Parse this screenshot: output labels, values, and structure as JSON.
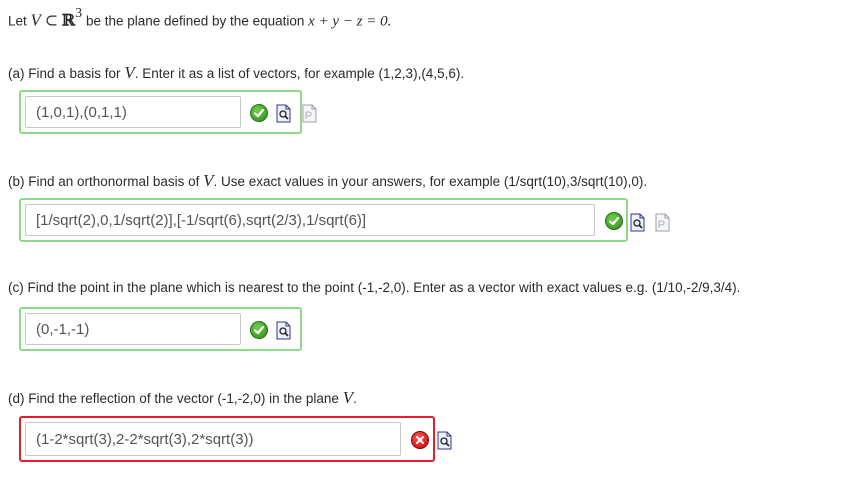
{
  "intro": {
    "prefix": "Let",
    "var": "V",
    "subset": "⊂",
    "space": "ℝ",
    "exp": "3",
    "suffix": "be the plane defined by the equation",
    "equation": "x + y − z = 0."
  },
  "parts": [
    {
      "question_prefix": "(a) Find a basis for",
      "question_var": "V",
      "question_suffix": ". Enter it as a list of vectors, for example (1,2,3),(4,5,6).",
      "answer": "(1,0,1),(0,1,1)",
      "status": "correct",
      "icons": [
        "preview-icon",
        "pdf-icon"
      ]
    },
    {
      "question_prefix": "(b) Find an orthonormal basis of",
      "question_var": "V",
      "question_suffix": ". Use exact values in your answers, for example (1/sqrt(10),3/sqrt(10),0).",
      "answer": "[1/sqrt(2),0,1/sqrt(2)],[-1/sqrt(6),sqrt(2/3),1/sqrt(6)]",
      "status": "correct",
      "icons": [
        "preview-icon",
        "pdf-icon"
      ]
    },
    {
      "question": "(c) Find the point in the plane which is nearest to the point (-1,-2,0). Enter as a vector with exact values e.g. (1/10,-2/9,3/4).",
      "answer": "(0,-1,-1)",
      "status": "correct",
      "icons": [
        "preview-icon"
      ]
    },
    {
      "question_prefix": "(d) Find the reflection of the vector (-1,-2,0) in the plane",
      "question_var": "V",
      "question_suffix": ".",
      "answer": "(1-2*sqrt(3),2-2*sqrt(3),2*sqrt(3))",
      "status": "incorrect",
      "icons": [
        "preview-icon"
      ]
    }
  ],
  "colors": {
    "correct_border": "#8fd98a",
    "incorrect_border": "#e0202a",
    "correct_icon": "#3a9a26",
    "incorrect_icon": "#d01010"
  }
}
